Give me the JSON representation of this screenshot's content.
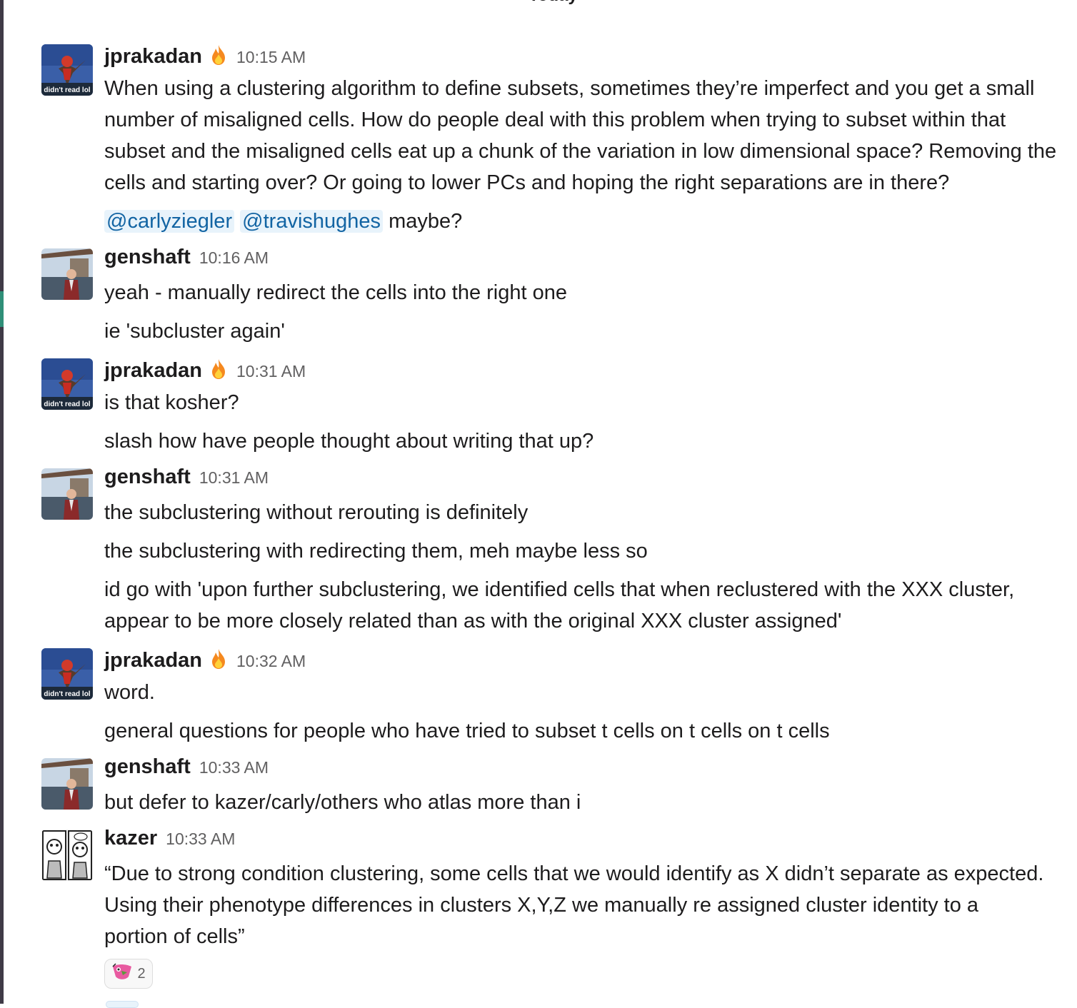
{
  "day_divider": "Today",
  "messages": [
    {
      "author": "jprakadan",
      "time": "10:15 AM",
      "avatar_text": "didn't read lol",
      "lines": [
        "When using a clustering algorithm to define subsets, sometimes they’re imperfect and you get a small",
        "number of misaligned cells. How do people deal with this problem when trying to subset within that",
        "subset and the misaligned cells eat up a chunk of the variation in low dimensional space? Removing the",
        "cells and starting over? Or going to lower PCs and hoping the right separations are in there?"
      ],
      "mentions": [
        "@carlyziegler",
        "@travishughes"
      ],
      "mention_tail": "maybe?"
    },
    {
      "author": "genshaft",
      "time": "10:16 AM",
      "lines": [
        "yeah - manually redirect the cells into the right one",
        "ie 'subcluster again'"
      ]
    },
    {
      "author": "jprakadan",
      "time": "10:31 AM",
      "avatar_text": "didn't read lol",
      "lines": [
        "is that kosher?",
        "slash how have people thought about writing that up?"
      ]
    },
    {
      "author": "genshaft",
      "time": "10:31 AM",
      "lines": [
        "the subclustering without rerouting is definitely",
        "the subclustering with redirecting them, meh maybe less so",
        "id go with 'upon further subclustering, we identified cells that when reclustered with the XXX cluster,",
        "appear to be more closely related than as with the original XXX cluster assigned'"
      ]
    },
    {
      "author": "jprakadan",
      "time": "10:32 AM",
      "avatar_text": "didn't read lol",
      "lines": [
        "word.",
        "general questions for people who have tried to subset t cells on t cells on t cells"
      ]
    },
    {
      "author": "genshaft",
      "time": "10:33 AM",
      "lines": [
        "but defer to kazer/carly/others who atlas more than i"
      ]
    },
    {
      "author": "kazer",
      "time": "10:33 AM",
      "lines": [
        "“Due to strong condition clustering, some cells that we would identify as X didn’t separate as expected.",
        "Using their phenotype differences in clusters X,Y,Z we manually re assigned cluster identity to a",
        "portion of cells”"
      ],
      "reaction": {
        "icon": "parrot-emoji-icon",
        "count": "2"
      }
    }
  ]
}
